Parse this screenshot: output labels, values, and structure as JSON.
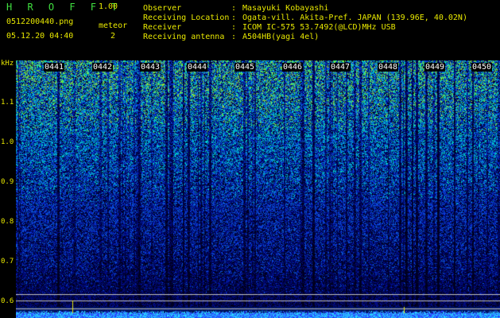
{
  "header": {
    "app_name": "H R O F F T",
    "version": "1.00",
    "filename": "0512200440.png",
    "datetime": "05.12.20 04:40",
    "meteor_label": "meteor",
    "meteor_count": "2"
  },
  "info": [
    {
      "label": "Observer",
      "value": "Masayuki Kobayashi"
    },
    {
      "label": "Receiving Location",
      "value": "Ogata-vill. Akita-Pref. JAPAN (139.96E, 40.02N)"
    },
    {
      "label": "Receiver",
      "value": "ICOM IC-575 53.7492(@LCD)MHz USB"
    },
    {
      "label": "Receiving antenna",
      "value": "A504HB(yagi 4el)"
    }
  ],
  "axis": {
    "unit": "kHz",
    "y_ticks": [
      "1.1",
      "1.0",
      "0.9",
      "0.8",
      "0.7",
      "0.6"
    ]
  },
  "time_labels": [
    "0441",
    "0442",
    "0443",
    "0444",
    "0445",
    "0446",
    "0447",
    "0448",
    "0449",
    "0450"
  ],
  "colors": {
    "text": "#e8e800",
    "title": "#40e040",
    "background": "#000000",
    "noise_low": "#0a1a8a",
    "noise_high": "#20e040",
    "baseline": "#40e8ff"
  }
}
